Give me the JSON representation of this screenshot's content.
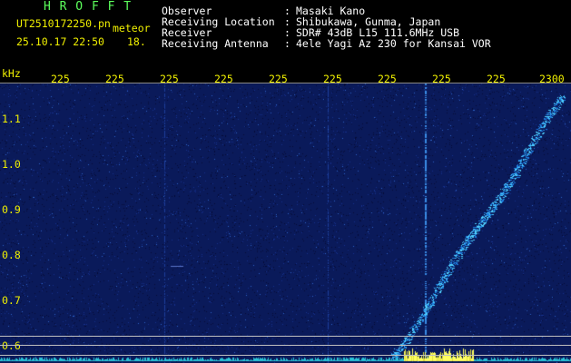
{
  "station": "H R O F F T",
  "filename": "UT2510172250.pn",
  "tag": "meteor",
  "datetime": "25.10.17 22:50",
  "count": "18.",
  "info": [
    {
      "label": "Observer",
      "sep": ":",
      "value": "Masaki Kano"
    },
    {
      "label": "Receiving Location",
      "sep": ":",
      "value": "Shibukawa, Gunma, Japan"
    },
    {
      "label": "Receiver",
      "sep": ":",
      "value": "SDR# 43dB L15 111.6MHz USB"
    },
    {
      "label": "Receiving Antenna",
      "sep": ":",
      "value": "4ele Yagi Az 230 for Kansai VOR"
    }
  ],
  "y_unit": "kHz",
  "x_ticks": [
    "225",
    "225",
    "225",
    "225",
    "225",
    "225",
    "225",
    "225",
    "225",
    "2300"
  ],
  "y_ticks": [
    "1.1",
    "1.0",
    "0.9",
    "0.8",
    "0.7",
    "0.6"
  ],
  "colors": {
    "header_green": "#5cff5c",
    "header_yellow": "#f0f000",
    "trace": "#4fd0ff",
    "signal": "#ffff60"
  }
}
